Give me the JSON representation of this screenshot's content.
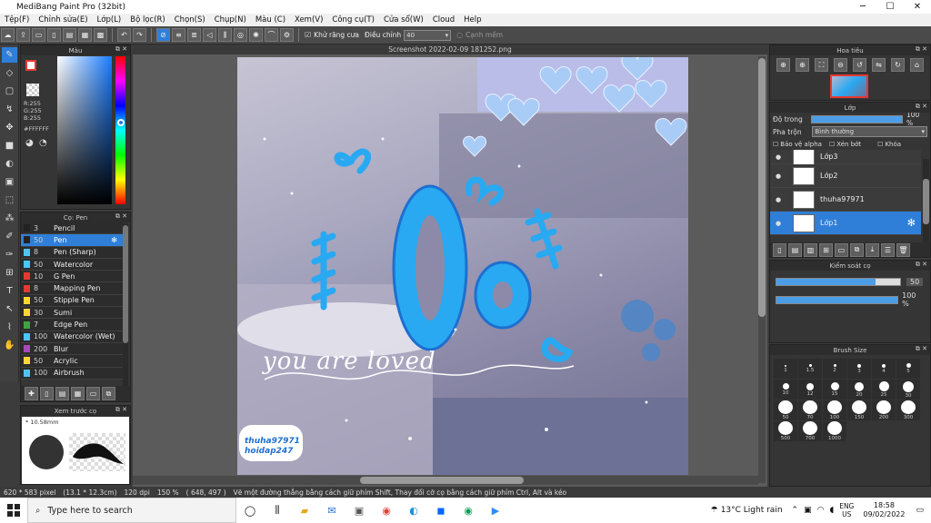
{
  "app": {
    "title": "MediBang Paint Pro (32bit)"
  },
  "window_controls": {
    "minimize": "─",
    "maximize": "☐",
    "close": "✕"
  },
  "menu": [
    "Tệp(F)",
    "Chỉnh sửa(E)",
    "Lớp(L)",
    "Bộ lọc(R)",
    "Chọn(S)",
    "Chụp(N)",
    "Màu (C)",
    "Xem(V)",
    "Công cụ(T)",
    "Cửa sổ(W)",
    "Cloud",
    "Help"
  ],
  "toolbar": {
    "antialias_label": "Khử răng cưa",
    "adjust_label": "Điều chỉnh",
    "adjust_value": "40",
    "smooth_label": "Cạnh mềm"
  },
  "color_panel": {
    "title": "Màu",
    "r": "R:255",
    "g": "G:255",
    "b": "B:255",
    "hex": "#FFFFFF"
  },
  "brush_panel": {
    "title": "Cọ: Pen",
    "items": [
      {
        "size": "3",
        "name": "Pencil",
        "color": "#222222"
      },
      {
        "size": "50",
        "name": "Pen",
        "color": "#222222"
      },
      {
        "size": "8",
        "name": "Pen (Sharp)",
        "color": "#4fc3f7"
      },
      {
        "size": "50",
        "name": "Watercolor",
        "color": "#4fc3f7"
      },
      {
        "size": "10",
        "name": "G Pen",
        "color": "#e53935"
      },
      {
        "size": "8",
        "name": "Mapping Pen",
        "color": "#e53935"
      },
      {
        "size": "50",
        "name": "Stipple Pen",
        "color": "#fdd835"
      },
      {
        "size": "30",
        "name": "Sumi",
        "color": "#fdd835"
      },
      {
        "size": "7",
        "name": "Edge Pen",
        "color": "#43a047"
      },
      {
        "size": "100",
        "name": "Watercolor (Wet)",
        "color": "#4fc3f7"
      },
      {
        "size": "200",
        "name": "Blur",
        "color": "#ab47bc"
      },
      {
        "size": "50",
        "name": "Acrylic",
        "color": "#fdd835"
      },
      {
        "size": "100",
        "name": "Airbrush",
        "color": "#4fc3f7"
      }
    ]
  },
  "preview_panel": {
    "title": "Xem trước cọ",
    "size": "* 10.58mm"
  },
  "document": {
    "tab": "Screenshot 2022-02-09 181252.png"
  },
  "artwork": {
    "script_text": "you are loved",
    "big_letters": "Oo",
    "watermark1": "thuha97971",
    "watermark2": "hoidap247"
  },
  "navigator": {
    "title": "Hoa tiêu"
  },
  "layer_panel": {
    "title": "Lớp",
    "opacity_label": "Độ trong",
    "opacity_value": "100 %",
    "opacity": 1.0,
    "blend_label": "Pha trộn",
    "blend_value": "Bình thường",
    "protect_alpha": "Bảo vệ alpha",
    "clipping": "Xén bớt",
    "lock": "Khóa",
    "layers": [
      {
        "name": "Lớp3",
        "selected": false
      },
      {
        "name": "Lớp2",
        "selected": false
      },
      {
        "name": "thuha97971",
        "selected": false
      },
      {
        "name": "Lớp1",
        "selected": true
      }
    ]
  },
  "brush_control": {
    "title": "Kiểm soát cọ",
    "size_value": "50",
    "size_fraction": 0.8,
    "opacity_value": "100 %",
    "opacity": 1.0
  },
  "brush_size": {
    "title": "Brush Size",
    "sizes": [
      "1",
      "1.5",
      "2",
      "3",
      "4",
      "5",
      "10",
      "12",
      "15",
      "20",
      "25",
      "30",
      "50",
      "70",
      "100",
      "150",
      "200",
      "300",
      "500",
      "700",
      "1000"
    ]
  },
  "status": {
    "dims": "620 * 583 pixel",
    "physical": "(13.1 * 12.3cm)",
    "dpi": "120 dpi",
    "zoom": "150 %",
    "coords": "( 648, 497 )",
    "hint": "Vẽ một đường thẳng bằng cách giữ phím Shift, Thay đổi cỡ cọ bằng cách giữ phím Ctrl, Alt và kéo"
  },
  "taskbar": {
    "search_placeholder": "Type here to search",
    "weather": "13°C  Light rain",
    "lang": "ENG",
    "region": "US",
    "time": "18:58",
    "date": "09/02/2022"
  }
}
